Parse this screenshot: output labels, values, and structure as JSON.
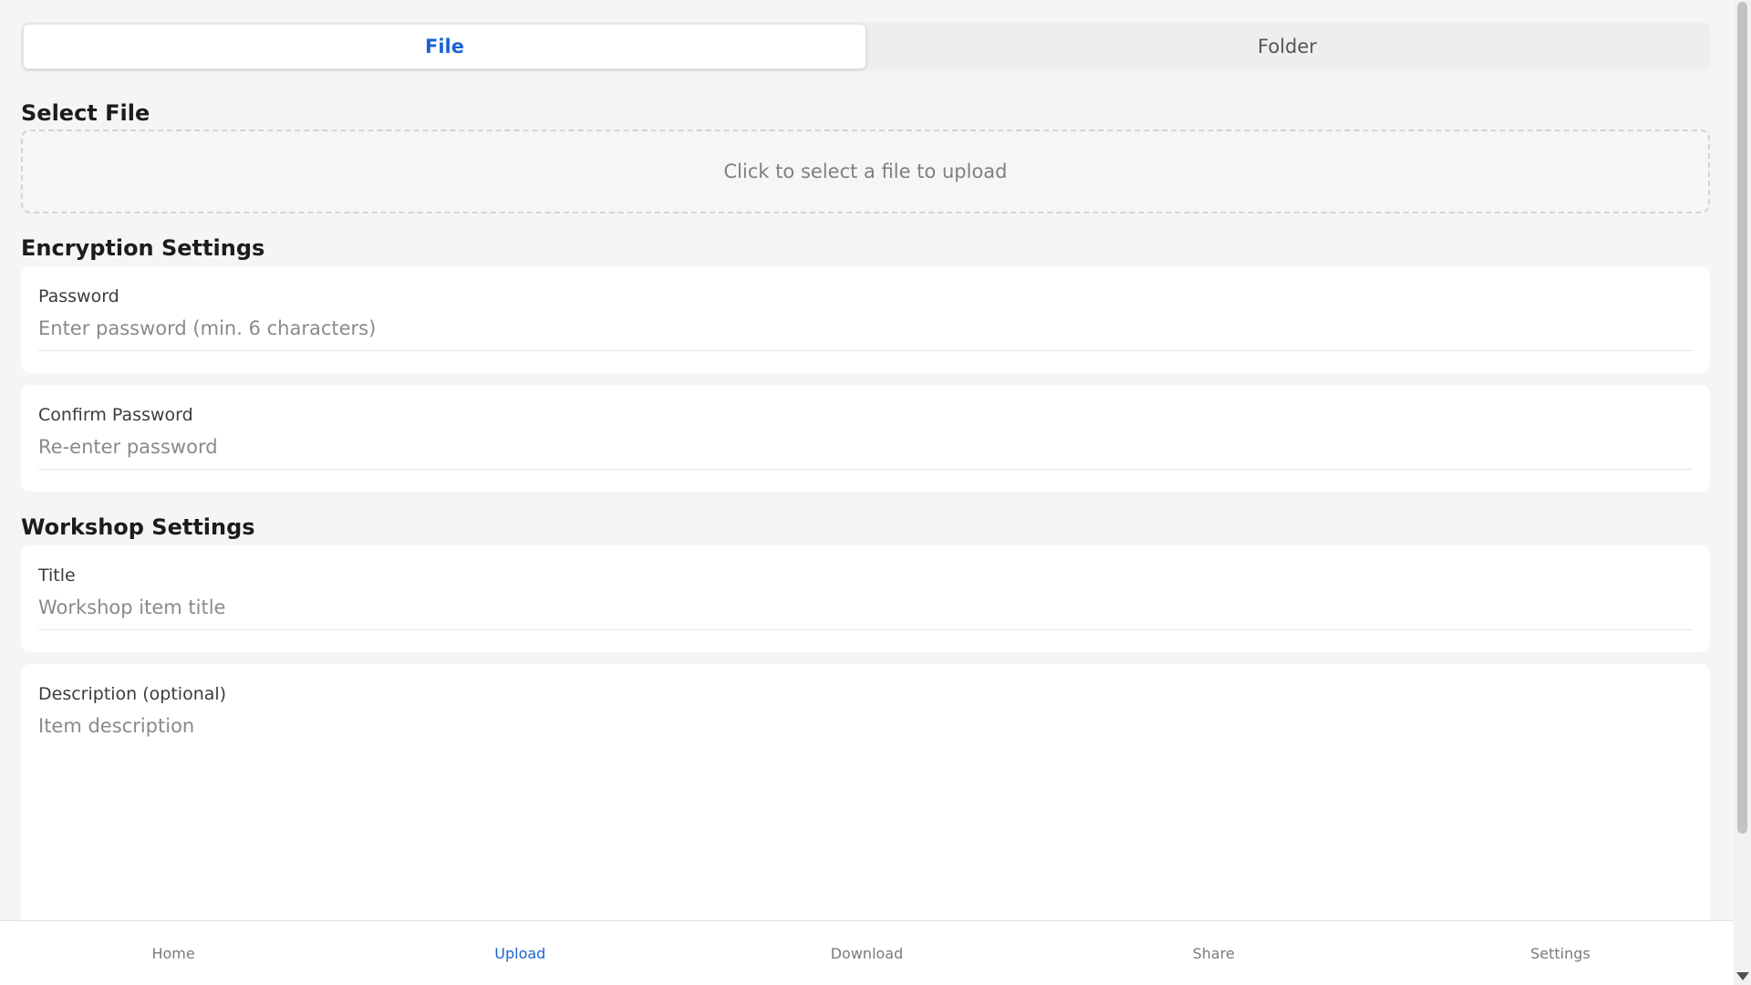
{
  "tabs": [
    {
      "label": "File",
      "active": true
    },
    {
      "label": "Folder",
      "active": false
    }
  ],
  "select_file": {
    "title": "Select File",
    "dropzone_text": "Click to select a file to upload"
  },
  "encryption": {
    "title": "Encryption Settings",
    "password": {
      "label": "Password",
      "value": "",
      "placeholder": "Enter password (min. 6 characters)"
    },
    "confirm_password": {
      "label": "Confirm Password",
      "value": "",
      "placeholder": "Re-enter password"
    }
  },
  "workshop": {
    "title": "Workshop Settings",
    "item_title": {
      "label": "Title",
      "value": "",
      "placeholder": "Workshop item title"
    },
    "description": {
      "label": "Description (optional)",
      "value": "",
      "placeholder": "Item description"
    }
  },
  "bottom_nav": [
    {
      "label": "Home",
      "active": false
    },
    {
      "label": "Upload",
      "active": true
    },
    {
      "label": "Download",
      "active": false
    },
    {
      "label": "Share",
      "active": false
    },
    {
      "label": "Settings",
      "active": false
    }
  ],
  "colors": {
    "accent": "#1a63d6",
    "background": "#f5f5f5",
    "card": "#ffffff"
  }
}
